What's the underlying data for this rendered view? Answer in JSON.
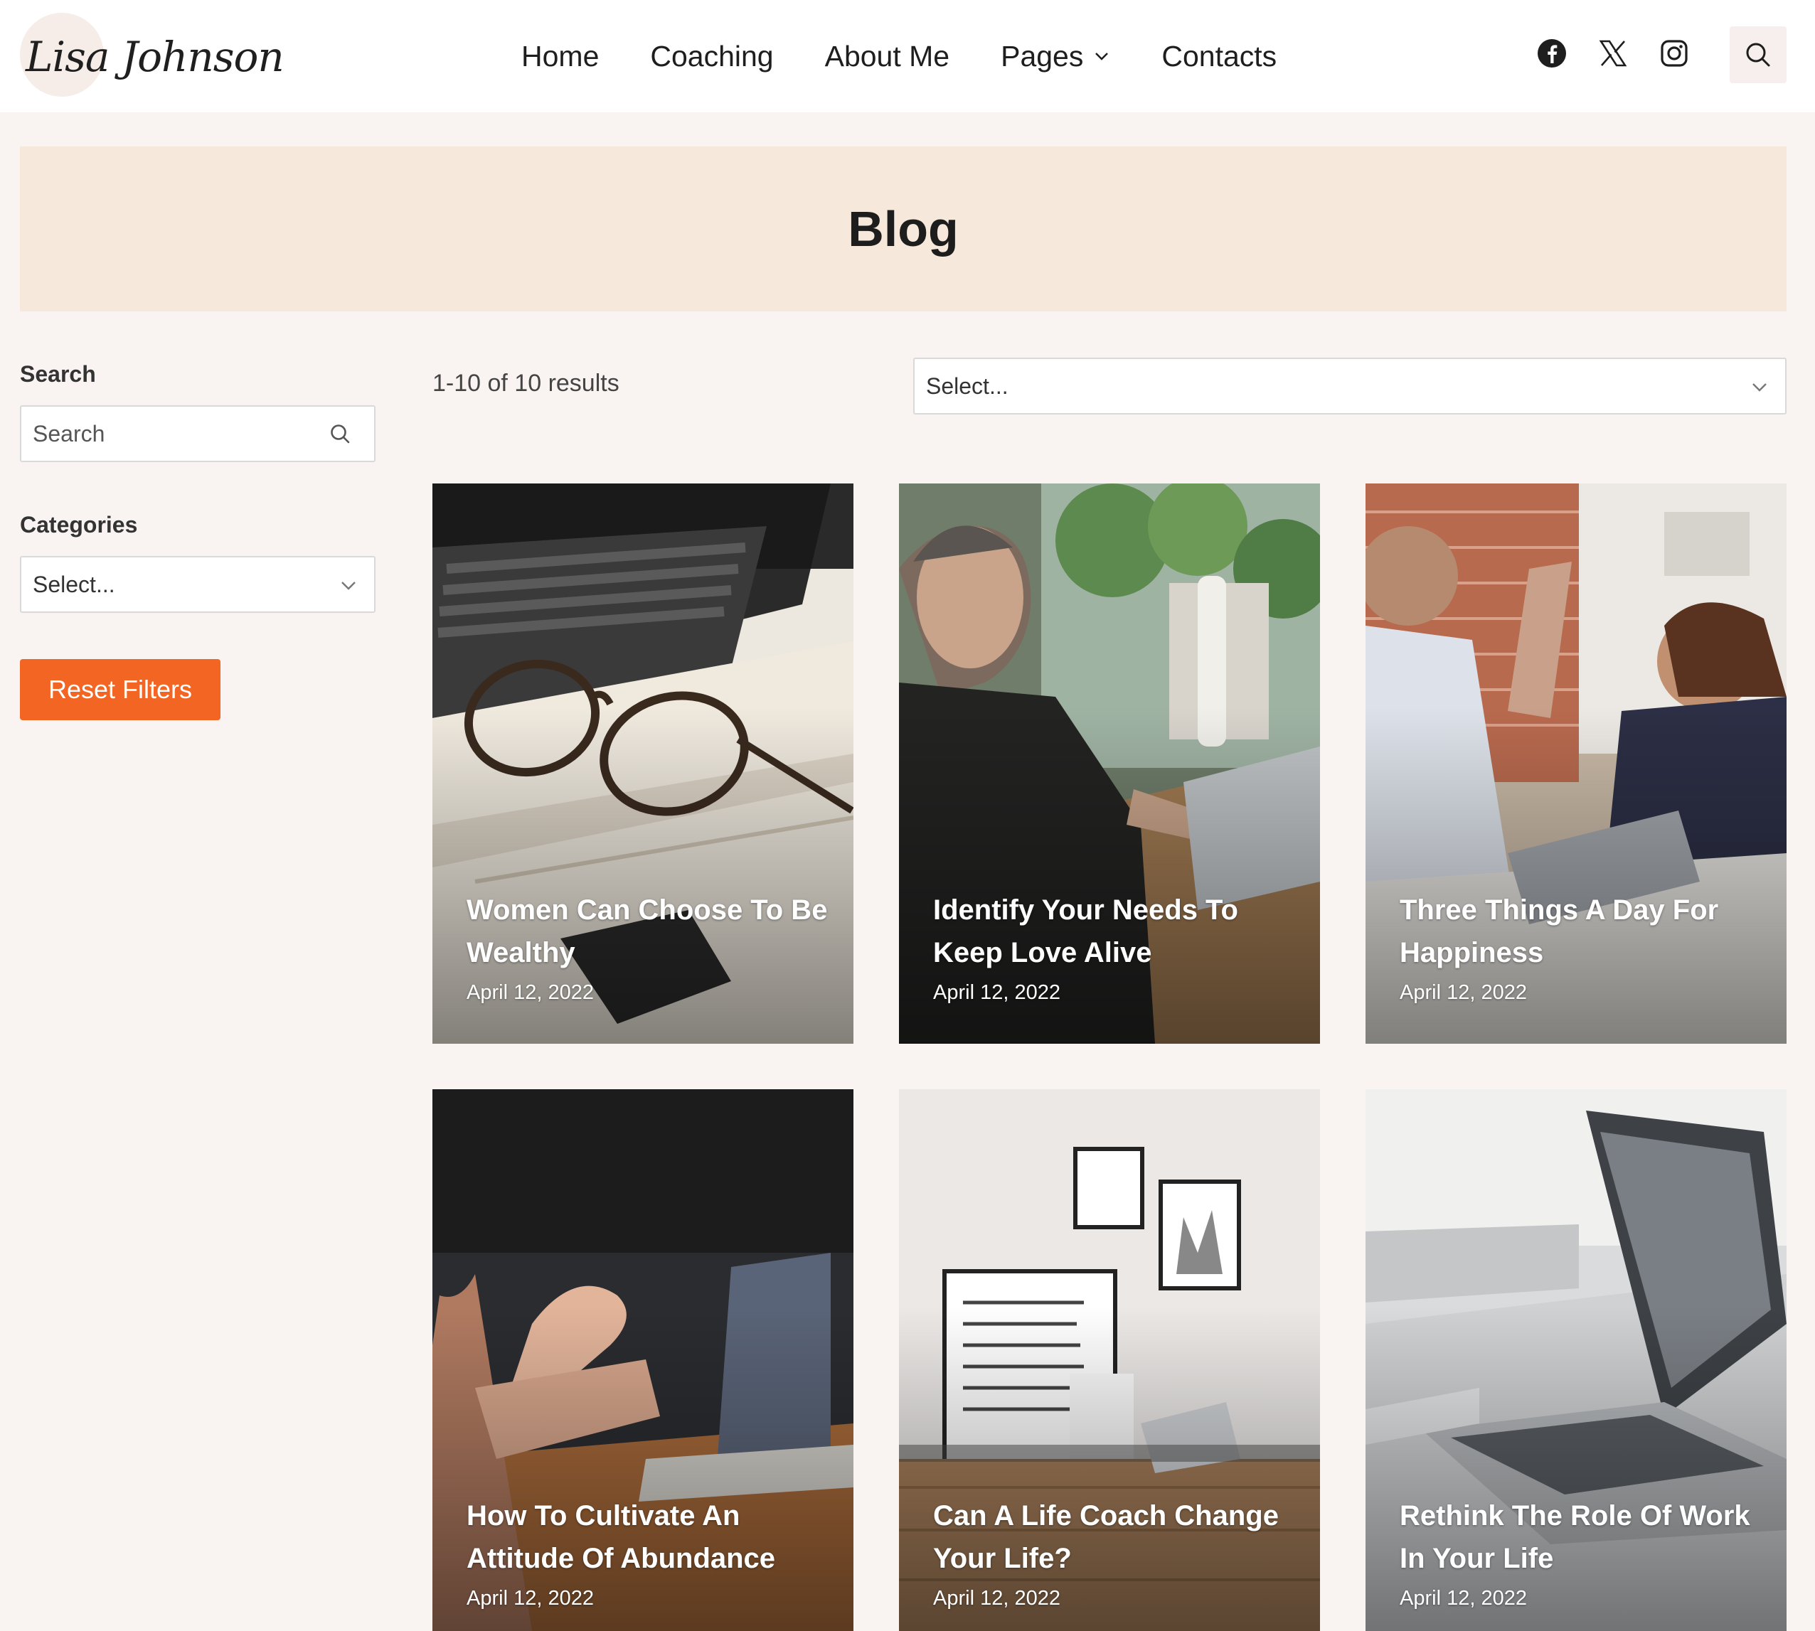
{
  "header": {
    "logo_text": "Lisa Johnson",
    "nav": [
      "Home",
      "Coaching",
      "About Me",
      "Pages",
      "Contacts"
    ],
    "social_icons": [
      "facebook-icon",
      "x-twitter-icon",
      "instagram-icon"
    ],
    "search_icon": "search-icon"
  },
  "banner": {
    "title": "Blog"
  },
  "sidebar": {
    "search_label": "Search",
    "search_placeholder": "Search",
    "categories_label": "Categories",
    "categories_value": "Select...",
    "reset_label": "Reset Filters"
  },
  "main": {
    "results_text": "1-10 of 10 results",
    "sort_value": "Select...",
    "posts": [
      {
        "title": "Women Can Choose To Be Wealthy",
        "date": "April 12, 2022"
      },
      {
        "title": "Identify Your Needs To Keep Love Alive",
        "date": "April 12, 2022"
      },
      {
        "title": "Three Things A Day For Happiness",
        "date": "April 12, 2022"
      },
      {
        "title": "How To Cultivate An Attitude Of Abundance",
        "date": "April 12, 2022"
      },
      {
        "title": "Can A Life Coach Change Your Life?",
        "date": "April 12, 2022"
      },
      {
        "title": "Rethink The Role Of Work In Your Life",
        "date": "April 12, 2022"
      }
    ]
  },
  "colors": {
    "accent": "#f26522",
    "banner_bg": "#f6e8db",
    "page_bg": "#f9f4f2"
  }
}
